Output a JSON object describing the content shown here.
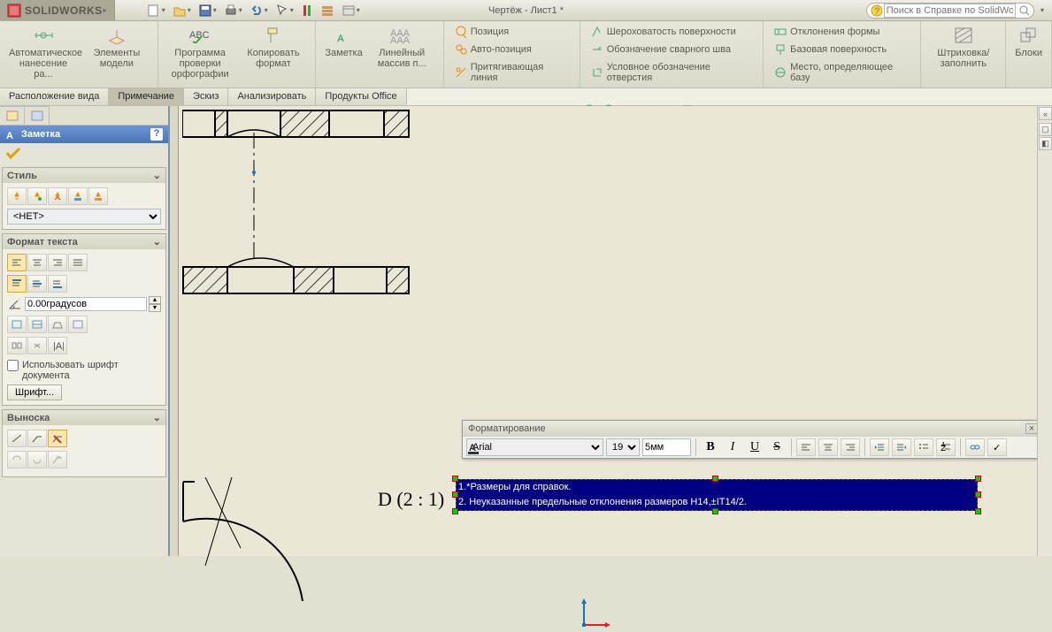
{
  "app": {
    "name": "SOLIDWORKS",
    "doc_title": "Чертёж - Лист1 *"
  },
  "search": {
    "placeholder": "Поиск в Справке по SolidWorks"
  },
  "ribbon": {
    "big": [
      {
        "label": "Автоматическое нанесение ра..."
      },
      {
        "label": "Элементы модели"
      },
      {
        "label": "Программа проверки орфографии"
      },
      {
        "label": "Копировать формат"
      },
      {
        "label": "Заметка"
      },
      {
        "label": "Линейный массив п..."
      }
    ],
    "col1": [
      "Позиция",
      "Авто-позиция",
      "Притягивающая линия"
    ],
    "col2": [
      "Шероховатость поверхности",
      "Обозначение сварного шва",
      "Условное обозначение отверстия"
    ],
    "col3": [
      "Отклонения формы",
      "Базовая поверхность",
      "Место, определяющее базу"
    ],
    "big2": [
      {
        "label": "Штриховка/заполнить"
      },
      {
        "label": "Блоки"
      }
    ]
  },
  "tabs": [
    "Расположение вида",
    "Примечание",
    "Эскиз",
    "Анализировать",
    "Продукты Office"
  ],
  "active_tab": "Примечание",
  "fm": {
    "header": "Заметка",
    "help": "?",
    "style": {
      "title": "Стиль",
      "select": "<НЕТ>"
    },
    "textfmt": {
      "title": "Формат текста",
      "angle": "0.00градусов",
      "use_doc_font": "Использовать шрифт документа",
      "font_btn": "Шрифт..."
    },
    "leader": {
      "title": "Выноска"
    }
  },
  "detail_label": "D  (2 : 1)",
  "fmt_toolbar": {
    "title": "Форматирование",
    "font": "Arial",
    "size": "19",
    "space": "5мм"
  },
  "note": {
    "line1": "1.*Размеры для справок.",
    "line2": "2. Неуказанные предельные отклонения размеров H14,±IT14/2."
  }
}
